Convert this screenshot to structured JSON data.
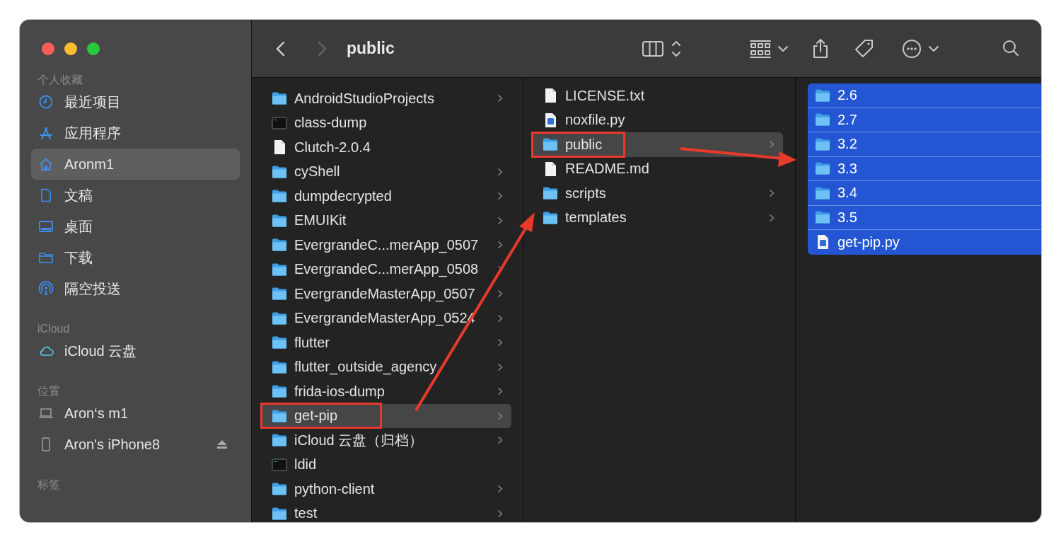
{
  "window": {
    "title": "public"
  },
  "toolbar": {
    "back_enabled": true,
    "forward_enabled": false
  },
  "sidebar": {
    "sections": [
      {
        "title": "个人收藏",
        "items": [
          {
            "label": "最近项目",
            "kind": "clock",
            "selected": false,
            "ejectable": false
          },
          {
            "label": "应用程序",
            "kind": "apps",
            "selected": false,
            "ejectable": false
          },
          {
            "label": "Aronm1",
            "kind": "home",
            "selected": true,
            "ejectable": false
          },
          {
            "label": "文稿",
            "kind": "doc",
            "selected": false,
            "ejectable": false
          },
          {
            "label": "桌面",
            "kind": "desktop",
            "selected": false,
            "ejectable": false
          },
          {
            "label": "下载",
            "kind": "folder",
            "selected": false,
            "ejectable": false
          },
          {
            "label": "隔空投送",
            "kind": "airdrop",
            "selected": false,
            "ejectable": false
          }
        ]
      },
      {
        "title": "iCloud",
        "items": [
          {
            "label": "iCloud 云盘",
            "kind": "cloud",
            "selected": false,
            "ejectable": false
          }
        ]
      },
      {
        "title": "位置",
        "items": [
          {
            "label": "Aron‘s m1",
            "kind": "laptop",
            "selected": false,
            "ejectable": false
          },
          {
            "label": "Aron's iPhone8",
            "kind": "phone",
            "selected": false,
            "ejectable": true
          }
        ]
      },
      {
        "title": "标签"
      }
    ]
  },
  "columns": [
    {
      "active": false,
      "items": [
        {
          "name": "AndroidStudioProjects",
          "kind": "folder",
          "disclosure": true,
          "selected": false,
          "annotated": false
        },
        {
          "name": "class-dump",
          "kind": "exec",
          "disclosure": false,
          "selected": false,
          "annotated": false
        },
        {
          "name": "Clutch-2.0.4",
          "kind": "file",
          "disclosure": false,
          "selected": false,
          "annotated": false
        },
        {
          "name": "cyShell",
          "kind": "folder",
          "disclosure": true,
          "selected": false,
          "annotated": false
        },
        {
          "name": "dumpdecrypted",
          "kind": "folder",
          "disclosure": true,
          "selected": false,
          "annotated": false
        },
        {
          "name": "EMUIKit",
          "kind": "folder",
          "disclosure": true,
          "selected": false,
          "annotated": false
        },
        {
          "name": "EvergrandeC...merApp_0507",
          "kind": "folder",
          "disclosure": true,
          "selected": false,
          "annotated": false
        },
        {
          "name": "EvergrandeC...merApp_0508",
          "kind": "folder",
          "disclosure": true,
          "selected": false,
          "annotated": false
        },
        {
          "name": "EvergrandeMasterApp_0507",
          "kind": "folder",
          "disclosure": true,
          "selected": false,
          "annotated": false
        },
        {
          "name": "EvergrandeMasterApp_0524",
          "kind": "folder",
          "disclosure": true,
          "selected": false,
          "annotated": false
        },
        {
          "name": "flutter",
          "kind": "folder",
          "disclosure": true,
          "selected": false,
          "annotated": false
        },
        {
          "name": "flutter_outside_agency",
          "kind": "folder",
          "disclosure": true,
          "selected": false,
          "annotated": false
        },
        {
          "name": "frida-ios-dump",
          "kind": "folder",
          "disclosure": true,
          "selected": false,
          "annotated": false
        },
        {
          "name": "get-pip",
          "kind": "folder",
          "disclosure": true,
          "selected": true,
          "annotated": true
        },
        {
          "name": "iCloud 云盘（归档）",
          "kind": "folder",
          "disclosure": true,
          "selected": false,
          "annotated": false
        },
        {
          "name": "ldid",
          "kind": "exec",
          "disclosure": false,
          "selected": false,
          "annotated": false
        },
        {
          "name": "python-client",
          "kind": "folder",
          "disclosure": true,
          "selected": false,
          "annotated": false
        },
        {
          "name": "test",
          "kind": "folder",
          "disclosure": true,
          "selected": false,
          "annotated": false
        }
      ]
    },
    {
      "active": false,
      "items": [
        {
          "name": "LICENSE.txt",
          "kind": "file",
          "disclosure": false,
          "selected": false,
          "annotated": false
        },
        {
          "name": "noxfile.py",
          "kind": "python",
          "disclosure": false,
          "selected": false,
          "annotated": false
        },
        {
          "name": "public",
          "kind": "folder",
          "disclosure": true,
          "selected": true,
          "annotated": true
        },
        {
          "name": "README.md",
          "kind": "file",
          "disclosure": false,
          "selected": false,
          "annotated": false
        },
        {
          "name": "scripts",
          "kind": "folder",
          "disclosure": true,
          "selected": false,
          "annotated": false
        },
        {
          "name": "templates",
          "kind": "folder",
          "disclosure": true,
          "selected": false,
          "annotated": false
        }
      ]
    },
    {
      "active": true,
      "items": [
        {
          "name": "2.6",
          "kind": "folder",
          "disclosure": false,
          "selected": true,
          "annotated": false
        },
        {
          "name": "2.7",
          "kind": "folder",
          "disclosure": false,
          "selected": true,
          "annotated": false
        },
        {
          "name": "3.2",
          "kind": "folder",
          "disclosure": false,
          "selected": true,
          "annotated": false
        },
        {
          "name": "3.3",
          "kind": "folder",
          "disclosure": false,
          "selected": true,
          "annotated": false
        },
        {
          "name": "3.4",
          "kind": "folder",
          "disclosure": false,
          "selected": true,
          "annotated": false
        },
        {
          "name": "3.5",
          "kind": "folder",
          "disclosure": false,
          "selected": true,
          "annotated": false
        },
        {
          "name": "get-pip.py",
          "kind": "python",
          "disclosure": false,
          "selected": true,
          "annotated": false
        }
      ]
    }
  ]
}
